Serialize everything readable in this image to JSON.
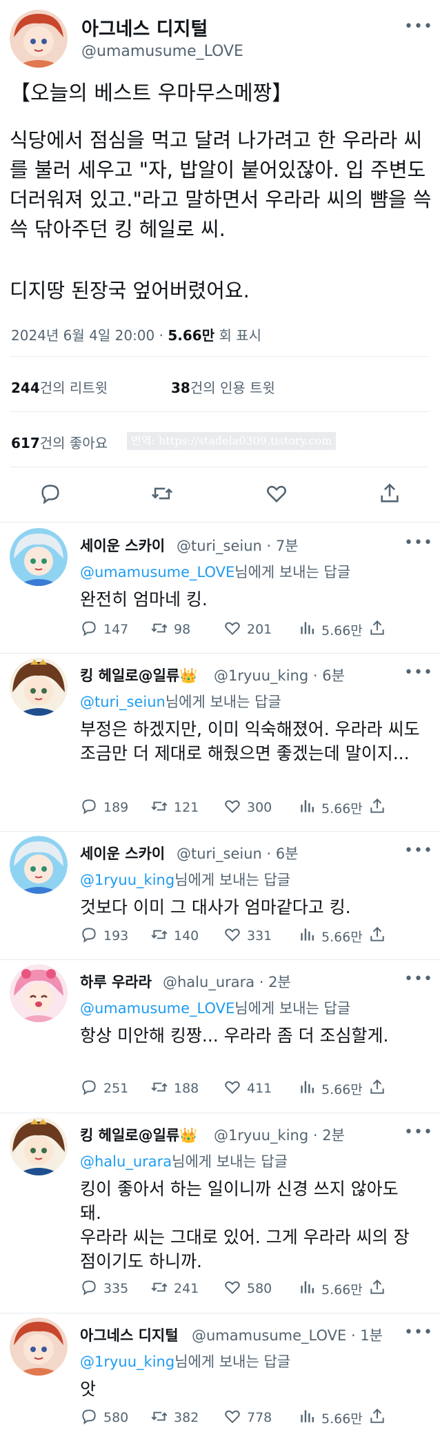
{
  "main": {
    "name": "아그네스 디지털",
    "handle": "@umamusume_LOVE",
    "title": "【오늘의 베스트 우마무스메짱】",
    "body": "식당에서 점심을 먹고 달려 나가려고 한 우라라 씨를 불러 세우고 \"자, 밥알이 붙어있잖아. 입 주변도 더러워져 있고.\"라고 말하면서 우라라 씨의 뺨을 쓱쓱 닦아주던 킹 헤일로 씨.",
    "body2": "디지땅 된장국 엎어버렸어요.",
    "timestamp": "2024년 6월 4일  20:00 · ",
    "views_value": "5.66만",
    "views_label": " 회 표시",
    "retweets_count": "244",
    "retweets_label": "건의 리트윗",
    "quotes_count": "38",
    "quotes_label": "건의 인용 트윗",
    "likes_count": "617",
    "likes_label": "건의 좋아요",
    "watermark": "번역: https://stadela0309.tistory.com"
  },
  "more_label": "•••",
  "reply_prefix_suffix": "님에게 보내는 답글",
  "replies": [
    {
      "name": "세이운 스카이",
      "handle": "@turi_seiun · 7분",
      "to": "@umamusume_LOVE",
      "text": "완전히 엄마네 킹.",
      "replies": "147",
      "retweets": "98",
      "likes": "201",
      "views": "5.66만"
    },
    {
      "name": "킹 헤일로@일류👑",
      "handle": "@1ryuu_king · 6분",
      "to": "@turi_seiun",
      "text": "부정은 하겠지만, 이미 익숙해졌어. 우라라 씨도 조금만 더 제대로 해줬으면 좋겠는데 말이지...",
      "replies": "189",
      "retweets": "121",
      "likes": "300",
      "views": "5.66만"
    },
    {
      "name": "세이운 스카이",
      "handle": "@turi_seiun · 6분",
      "to": "@1ryuu_king",
      "text": "것보다 이미 그 대사가 엄마같다고 킹.",
      "replies": "193",
      "retweets": "140",
      "likes": "331",
      "views": "5.66만"
    },
    {
      "name": "하루 우라라",
      "handle": "@halu_urara · 2분",
      "to": "@umamusume_LOVE",
      "text": "항상 미안해 킹짱... 우라라 좀 더 조심할게.",
      "replies": "251",
      "retweets": "188",
      "likes": "411",
      "views": "5.66만"
    },
    {
      "name": "킹 헤일로@일류👑",
      "handle": "@1ryuu_king · 2분",
      "to": "@halu_urara",
      "text": "킹이 좋아서 하는 일이니까 신경 쓰지 않아도 돼.\n우라라 씨는 그대로 있어. 그게 우라라 씨의 장점이기도 하니까.",
      "replies": "335",
      "retweets": "241",
      "likes": "580",
      "views": "5.66만"
    },
    {
      "name": "아그네스 디지털",
      "handle": "@umamusume_LOVE · 1분",
      "to": "@1ryuu_king",
      "text": "앗",
      "replies": "580",
      "retweets": "382",
      "likes": "778",
      "views": "5.66만"
    }
  ],
  "colors": {
    "link": "#1d9bf0",
    "secondary": "#536471",
    "text": "#0f1419"
  },
  "icons": [
    "reply-icon",
    "retweet-icon",
    "like-icon",
    "views-icon",
    "share-icon"
  ]
}
